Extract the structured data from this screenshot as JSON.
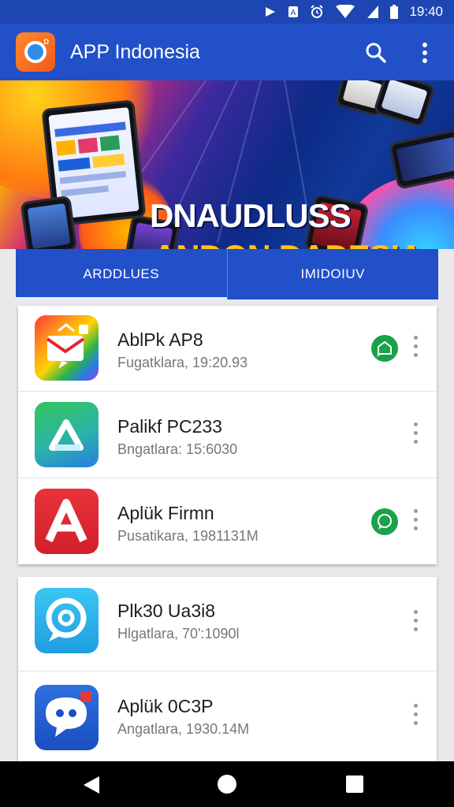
{
  "status_bar": {
    "time": "19:40",
    "icons": [
      "media-play-icon",
      "notification-icon",
      "alarm-icon",
      "wifi-icon",
      "battery-icon"
    ]
  },
  "app_bar": {
    "title": "APP Indonesia",
    "icons": [
      "app-logo",
      "search-icon",
      "overflow-menu-icon"
    ]
  },
  "banner": {
    "line1": "DNAUDLUSS",
    "line2": "ANDON DADESIA"
  },
  "tabs": [
    {
      "label": "ARDDLUES",
      "active": true
    },
    {
      "label": "IMIDOIUV",
      "active": false
    }
  ],
  "apps": [
    {
      "name": "AblPk AP8",
      "subtitle": "Fugatklara, 19:20.93",
      "badge": true,
      "icon": "mail-app-icon"
    },
    {
      "name": "Palikf PC233",
      "subtitle": "Bngatlara: 15:6030",
      "badge": false,
      "icon": "drive-app-icon"
    },
    {
      "name": "Aplük Firmn",
      "subtitle": "Pusatikara, 1981131M",
      "badge": true,
      "icon": "letter-a-app-icon"
    },
    {
      "name": "Plk30 Ua3i8",
      "subtitle": "Hlgatlara, 70':1090l",
      "badge": false,
      "icon": "chat-bubble-app-icon"
    },
    {
      "name": "Aplük 0C3P",
      "subtitle": "Angatlara, 1930.14M",
      "badge": false,
      "icon": "messenger-app-icon"
    }
  ],
  "colors": {
    "primary": "#2150c8",
    "status_bar": "#1d46b3",
    "badge": "#1aa24a",
    "banner_text_accent": "#ffc21a"
  },
  "nav_bar": {
    "icons": [
      "back-icon",
      "home-icon",
      "recent-apps-icon"
    ]
  }
}
